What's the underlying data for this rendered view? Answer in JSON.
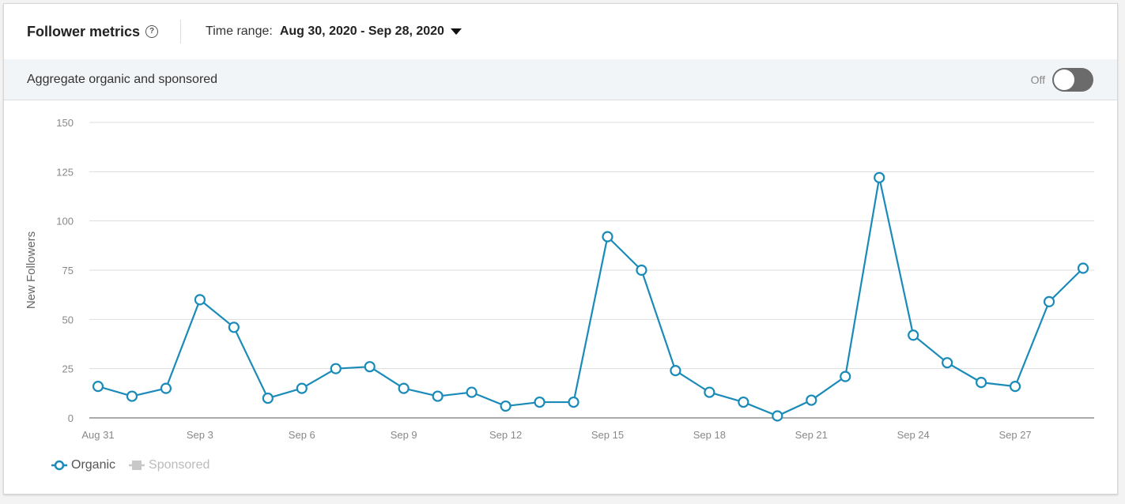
{
  "header": {
    "title": "Follower metrics",
    "help_icon": "question-circle-icon",
    "time_range_label": "Time range:",
    "time_range_value": "Aug 30, 2020 - Sep 28, 2020",
    "dropdown_icon": "caret-down-icon"
  },
  "subbar": {
    "label": "Aggregate organic and sponsored",
    "toggle_label": "Off",
    "toggle_state": false
  },
  "colors": {
    "organic": "#1a8bb8",
    "sponsored": "#c8c8c8",
    "grid": "#dddddd",
    "axis": "#aaaaaa"
  },
  "chart_data": {
    "type": "line",
    "title": "Follower metrics",
    "xlabel": "",
    "ylabel": "New Followers",
    "ylim": [
      0,
      150
    ],
    "yticks": [
      0,
      25,
      50,
      75,
      100,
      125,
      150
    ],
    "grid": true,
    "legend_position": "bottom-left",
    "x": [
      "Aug 31",
      "Sep 1",
      "Sep 2",
      "Sep 3",
      "Sep 4",
      "Sep 5",
      "Sep 6",
      "Sep 7",
      "Sep 8",
      "Sep 9",
      "Sep 10",
      "Sep 11",
      "Sep 12",
      "Sep 13",
      "Sep 14",
      "Sep 15",
      "Sep 16",
      "Sep 17",
      "Sep 18",
      "Sep 19",
      "Sep 20",
      "Sep 21",
      "Sep 22",
      "Sep 23",
      "Sep 24",
      "Sep 25",
      "Sep 26",
      "Sep 27",
      "Sep 28",
      "Sep 29"
    ],
    "xtick_labels": [
      {
        "index": 0,
        "label": "Aug 31"
      },
      {
        "index": 3,
        "label": "Sep 3"
      },
      {
        "index": 6,
        "label": "Sep 6"
      },
      {
        "index": 9,
        "label": "Sep 9"
      },
      {
        "index": 12,
        "label": "Sep 12"
      },
      {
        "index": 15,
        "label": "Sep 15"
      },
      {
        "index": 18,
        "label": "Sep 18"
      },
      {
        "index": 21,
        "label": "Sep 21"
      },
      {
        "index": 24,
        "label": "Sep 24"
      },
      {
        "index": 27,
        "label": "Sep 27"
      }
    ],
    "series": [
      {
        "name": "Organic",
        "enabled": true,
        "values": [
          16,
          11,
          15,
          60,
          46,
          10,
          15,
          25,
          26,
          15,
          11,
          13,
          6,
          8,
          8,
          92,
          75,
          24,
          13,
          8,
          1,
          9,
          21,
          122,
          42,
          28,
          18,
          16,
          59,
          76
        ]
      },
      {
        "name": "Sponsored",
        "enabled": false,
        "values": []
      }
    ]
  }
}
